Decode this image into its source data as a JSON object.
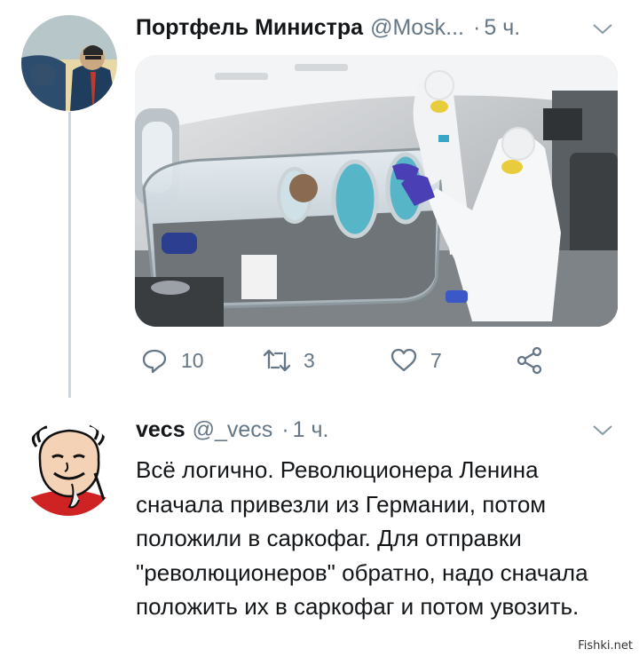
{
  "tweet": {
    "author_name": "Портфель Министра",
    "handle": "@Mosk...",
    "dot": "·",
    "time": "5 ч.",
    "actions": {
      "reply_count": "10",
      "retweet_count": "3",
      "like_count": "7"
    }
  },
  "reply": {
    "author_name": "vecs",
    "handle": "@_vecs",
    "dot": "·",
    "time": "1 ч.",
    "text": "Всё логично. Революционера Ленина сначала привезли из Германии, потом положили в саркофаг. Для отправки \"революционеров\" обратно, надо сначала положить их в саркофаг и потом увозить."
  },
  "watermark": "Fishki.net",
  "icons": {
    "reply": "reply-icon",
    "retweet": "retweet-icon",
    "like": "heart-icon",
    "share": "share-icon",
    "menu": "chevron-down-icon"
  },
  "colors": {
    "text_primary": "#14171a",
    "text_secondary": "#657786",
    "thread_line": "#ccd6dd"
  }
}
